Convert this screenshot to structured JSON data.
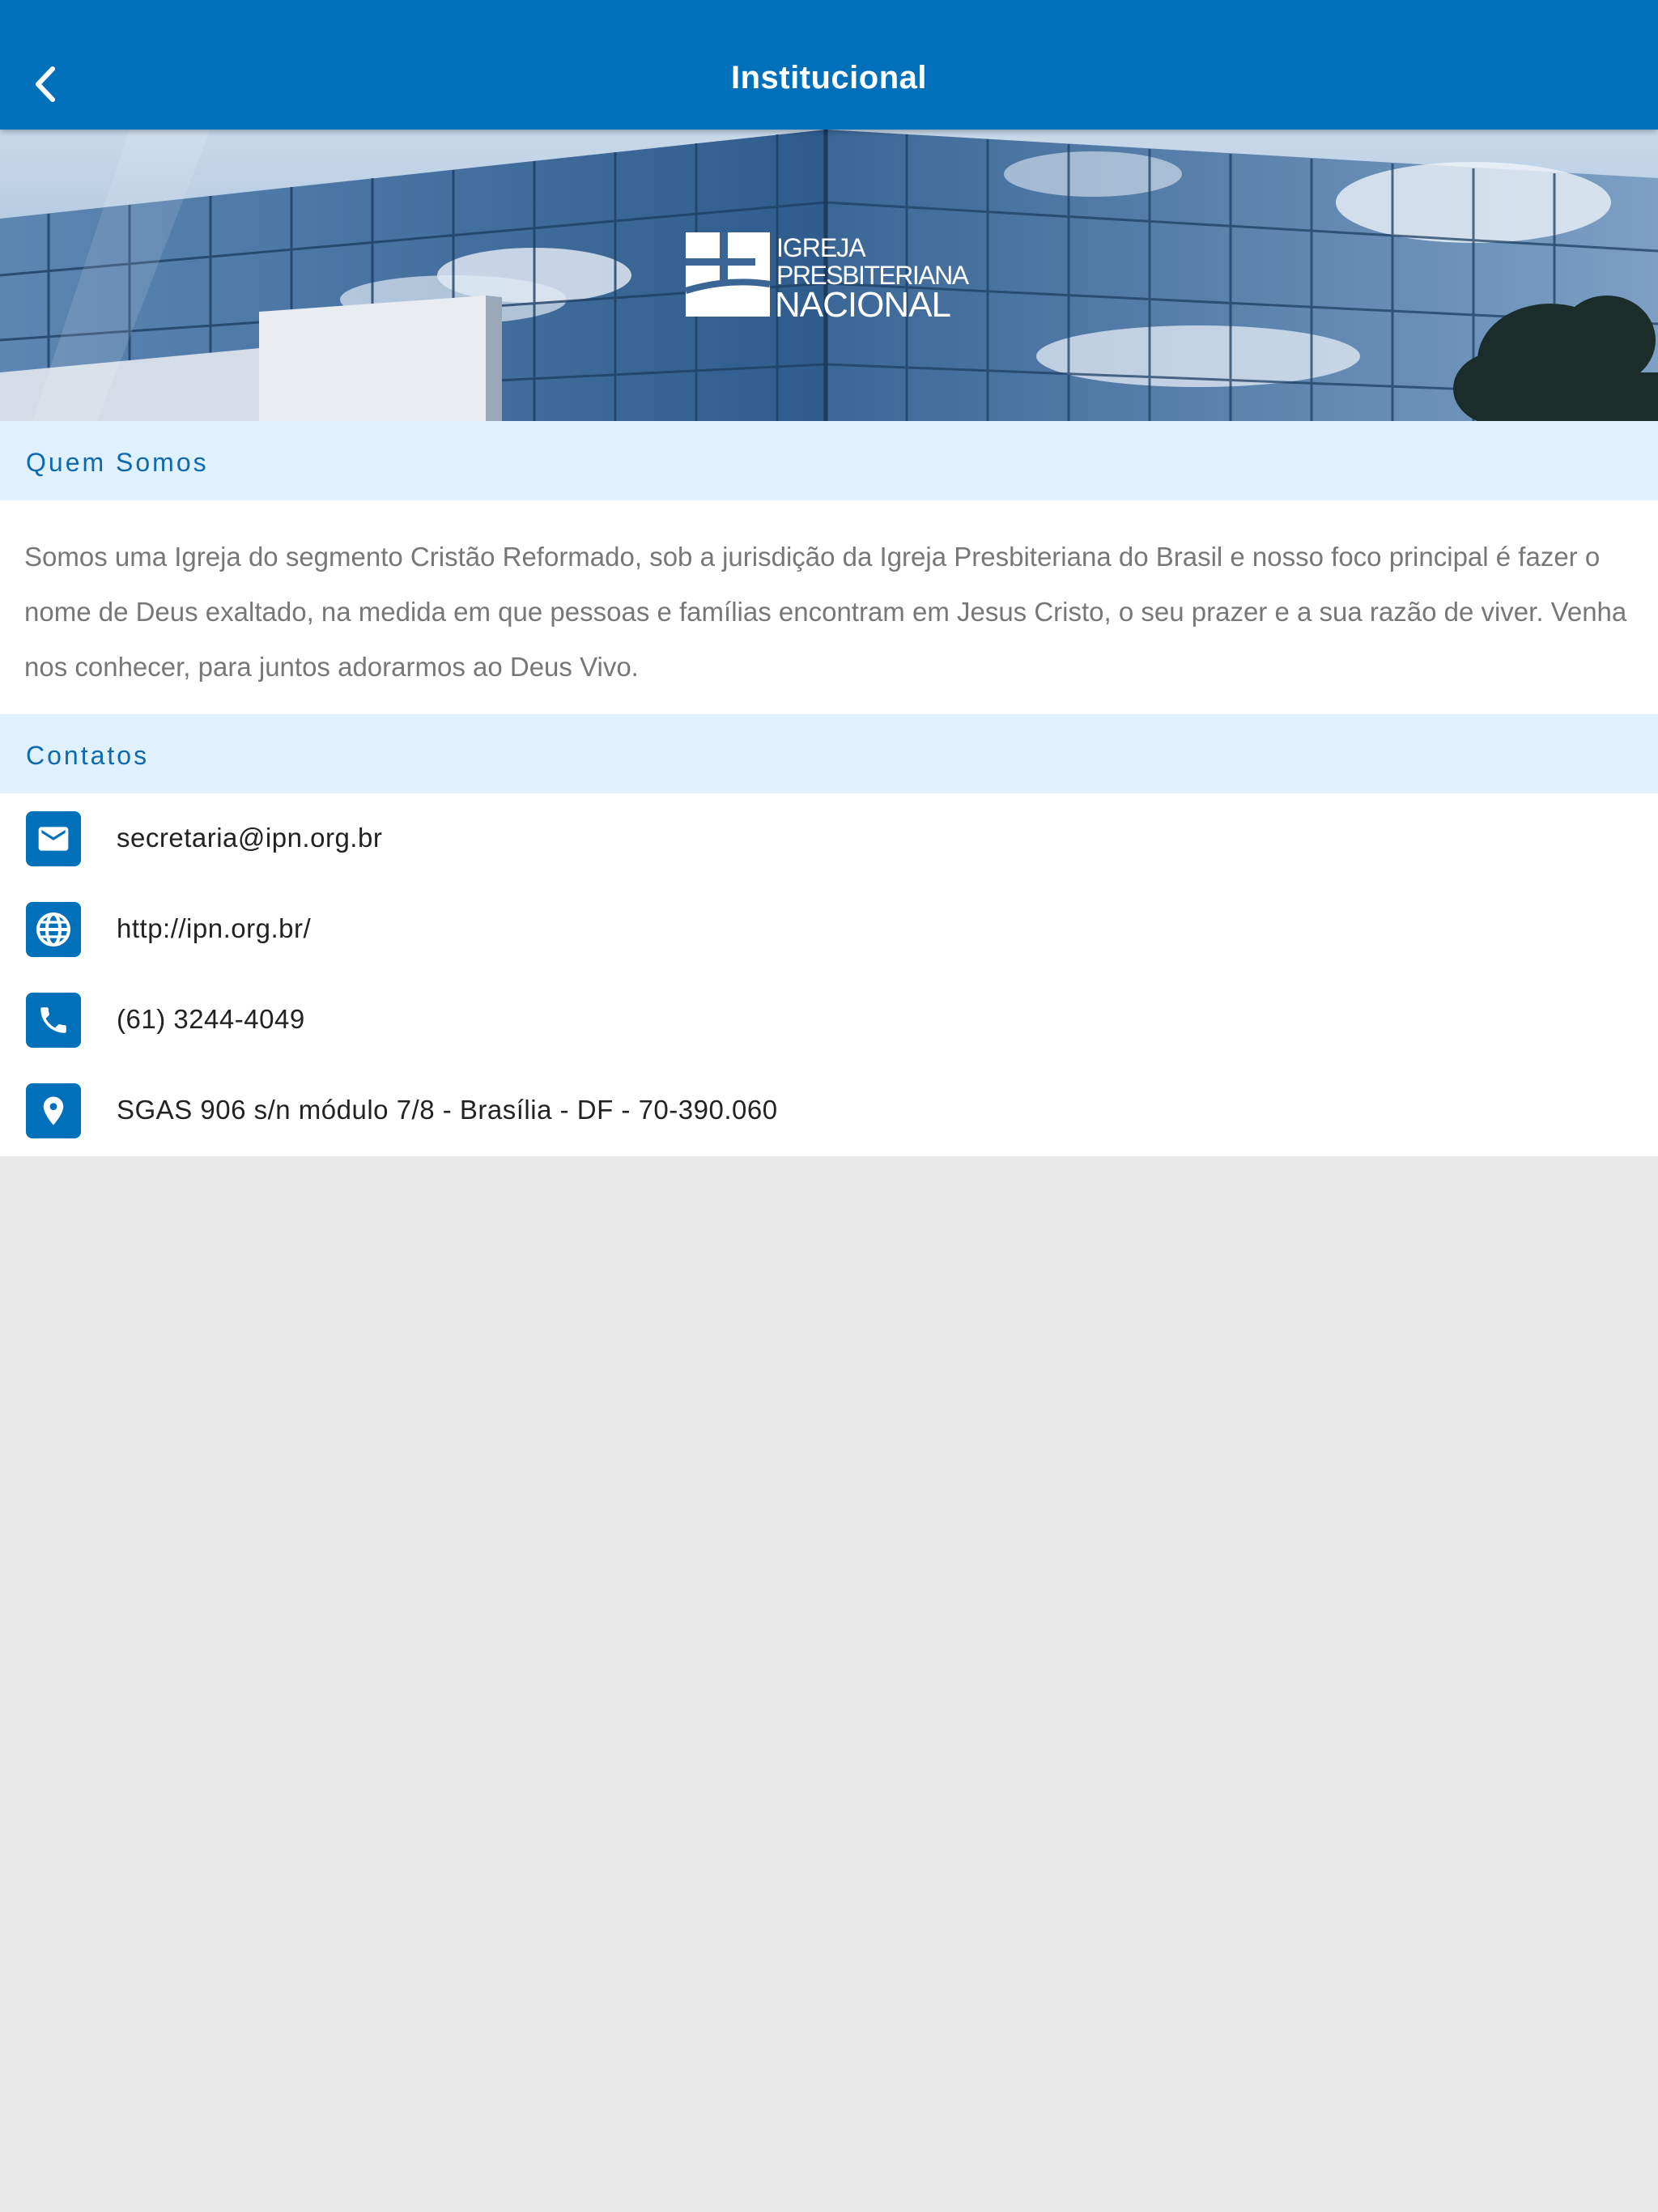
{
  "navbar": {
    "title": "Institucional",
    "back_icon": "chevron-left-icon",
    "color": "#0070ba"
  },
  "hero": {
    "logo_text": {
      "line1": "IGREJA",
      "line2": "PRESBITERIANA",
      "line3": "NACIONAL"
    }
  },
  "about": {
    "header": "Quem Somos",
    "text": "Somos uma Igreja do segmento Cristão Reformado, sob a jurisdição da Igreja Presbiteriana do Brasil e nosso foco principal é fazer o nome de Deus exaltado, na medida em que pessoas e famílias encontram em Jesus Cristo, o seu prazer e a sua razão de viver. Venha nos conhecer, para juntos adorarmos ao Deus Vivo."
  },
  "contacts": {
    "header": "Contatos",
    "items": [
      {
        "icon": "email-icon",
        "text": "secretaria@ipn.org.br"
      },
      {
        "icon": "globe-icon",
        "text": "http://ipn.org.br/"
      },
      {
        "icon": "phone-icon",
        "text": "(61) 3244-4049"
      },
      {
        "icon": "location-pin-icon",
        "text": "SGAS 906 s/n módulo 7/8 - Brasília - DF - 70-390.060"
      }
    ]
  },
  "colors": {
    "primary": "#0070ba",
    "section_header_bg": "#dff0fe",
    "section_header_text": "#0f6aad",
    "body_text": "#777777",
    "page_bg": "#e8e8e8"
  }
}
